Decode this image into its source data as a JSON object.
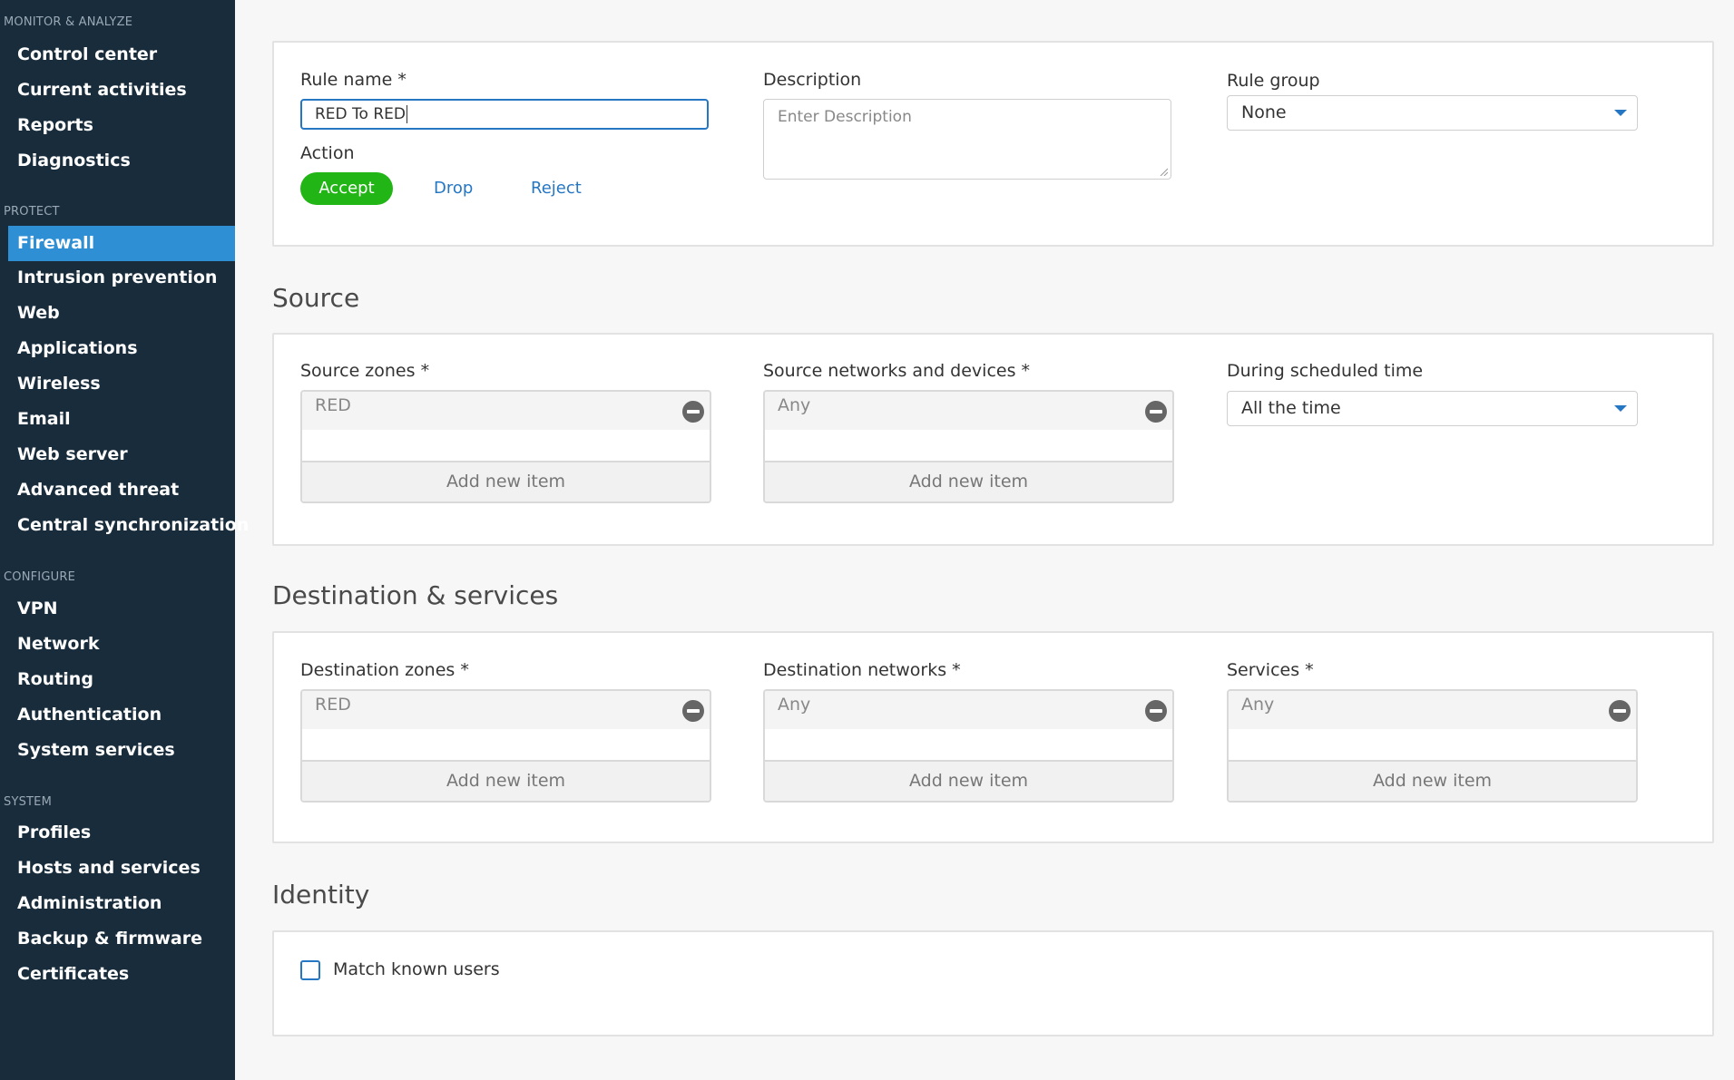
{
  "sidebar": {
    "monitor": {
      "heading": "MONITOR & ANALYZE",
      "items": [
        "Control center",
        "Current activities",
        "Reports",
        "Diagnostics"
      ]
    },
    "protect": {
      "heading": "PROTECT",
      "items": [
        "Firewall",
        "Intrusion prevention",
        "Web",
        "Applications",
        "Wireless",
        "Email",
        "Web server",
        "Advanced threat",
        "Central synchronization"
      ]
    },
    "configure": {
      "heading": "CONFIGURE",
      "items": [
        "VPN",
        "Network",
        "Routing",
        "Authentication",
        "System services"
      ]
    },
    "system": {
      "heading": "SYSTEM",
      "items": [
        "Profiles",
        "Hosts and services",
        "Administration",
        "Backup & firmware",
        "Certificates"
      ]
    },
    "active_item": "Firewall",
    "colors": {
      "background": "#182c3b",
      "active": "#2e8fd5"
    }
  },
  "rule": {
    "name_label": "Rule name *",
    "name_value": "RED To RED",
    "action_label": "Action",
    "actions": {
      "accept": "Accept",
      "drop": "Drop",
      "reject": "Reject"
    },
    "selected_action": "Accept",
    "description_label": "Description",
    "description_placeholder": "Enter Description",
    "group_label": "Rule group",
    "group_value": "None"
  },
  "source": {
    "title": "Source",
    "zones_label": "Source zones *",
    "zones_item": "RED",
    "networks_label": "Source networks and devices *",
    "networks_item": "Any",
    "schedule_label": "During scheduled time",
    "schedule_value": "All the time"
  },
  "destination": {
    "title": "Destination & services",
    "zones_label": "Destination zones *",
    "zones_item": "RED",
    "networks_label": "Destination networks *",
    "networks_item": "Any",
    "services_label": "Services *",
    "services_item": "Any"
  },
  "identity": {
    "title": "Identity",
    "match_label": "Match known users",
    "match_checked": false
  },
  "common": {
    "add_new_item": "Add new item"
  },
  "colors": {
    "accent": "#2577c4",
    "accept_green": "#21b516"
  }
}
